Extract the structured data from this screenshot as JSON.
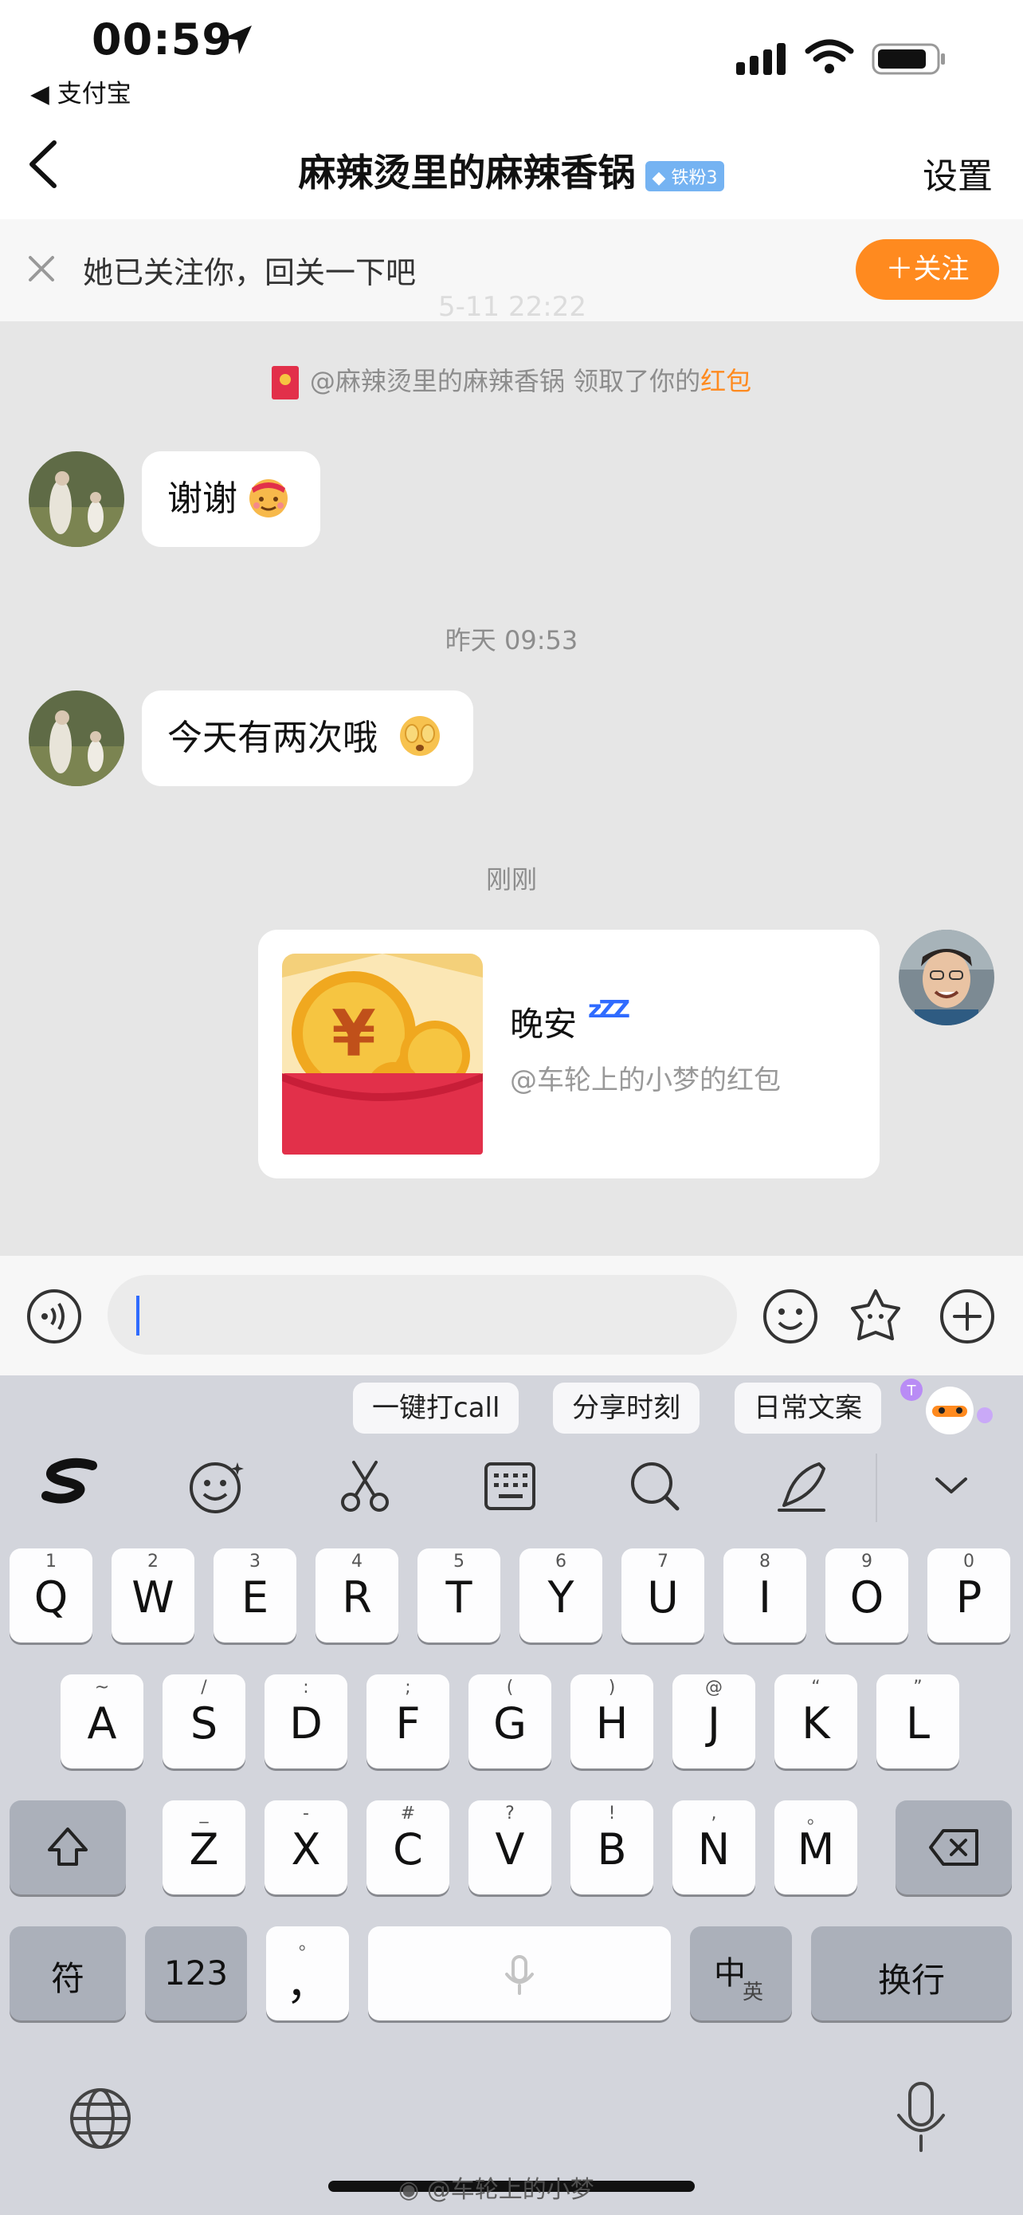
{
  "status_bar": {
    "time": "00:59",
    "back_app": "◀ 支付宝"
  },
  "header": {
    "title": "麻辣烫里的麻辣香锅",
    "badge": "铁粉3",
    "settings": "设置"
  },
  "follow_bar": {
    "text": "她已关注你，回关一下吧",
    "button": "＋关注",
    "ghost_time": "5-11 22:22"
  },
  "chat": {
    "notice_prefix": "@麻辣烫里的麻辣香锅 领取了你的",
    "notice_link": "红包",
    "msg1": "谢谢",
    "time2": "昨天 09:53",
    "msg2": "今天有两次哦",
    "time3": "刚刚",
    "red_packet": {
      "title": "晚安",
      "zz": "zZZ",
      "subtitle": "@车轮上的小梦的红包"
    }
  },
  "suggestions": [
    "一键打call",
    "分享时刻",
    "日常文案"
  ],
  "keyboard": {
    "row1": [
      {
        "k": "Q",
        "h": "1"
      },
      {
        "k": "W",
        "h": "2"
      },
      {
        "k": "E",
        "h": "3"
      },
      {
        "k": "R",
        "h": "4"
      },
      {
        "k": "T",
        "h": "5"
      },
      {
        "k": "Y",
        "h": "6"
      },
      {
        "k": "U",
        "h": "7"
      },
      {
        "k": "I",
        "h": "8"
      },
      {
        "k": "O",
        "h": "9"
      },
      {
        "k": "P",
        "h": "0"
      }
    ],
    "row2": [
      {
        "k": "A",
        "h": "~"
      },
      {
        "k": "S",
        "h": "/"
      },
      {
        "k": "D",
        "h": ":"
      },
      {
        "k": "F",
        "h": ";"
      },
      {
        "k": "G",
        "h": "("
      },
      {
        "k": "H",
        "h": ")"
      },
      {
        "k": "J",
        "h": "@"
      },
      {
        "k": "K",
        "h": "“"
      },
      {
        "k": "L",
        "h": "”"
      }
    ],
    "row3": [
      {
        "k": "Z",
        "h": "_"
      },
      {
        "k": "X",
        "h": "-"
      },
      {
        "k": "C",
        "h": "#"
      },
      {
        "k": "V",
        "h": "?"
      },
      {
        "k": "B",
        "h": "!"
      },
      {
        "k": "N",
        "h": ","
      },
      {
        "k": "M",
        "h": "。"
      }
    ],
    "fu": "符",
    "num": "123",
    "comma": "，",
    "comma_hint": "。",
    "zh": "中",
    "en": "英",
    "enter": "换行"
  },
  "watermark": "@车轮上的小梦",
  "colors": {
    "accent_orange": "#ff8a1f",
    "link": "#ff8a1f",
    "red_packet": "#e2304a",
    "cursor": "#2f6bff"
  }
}
